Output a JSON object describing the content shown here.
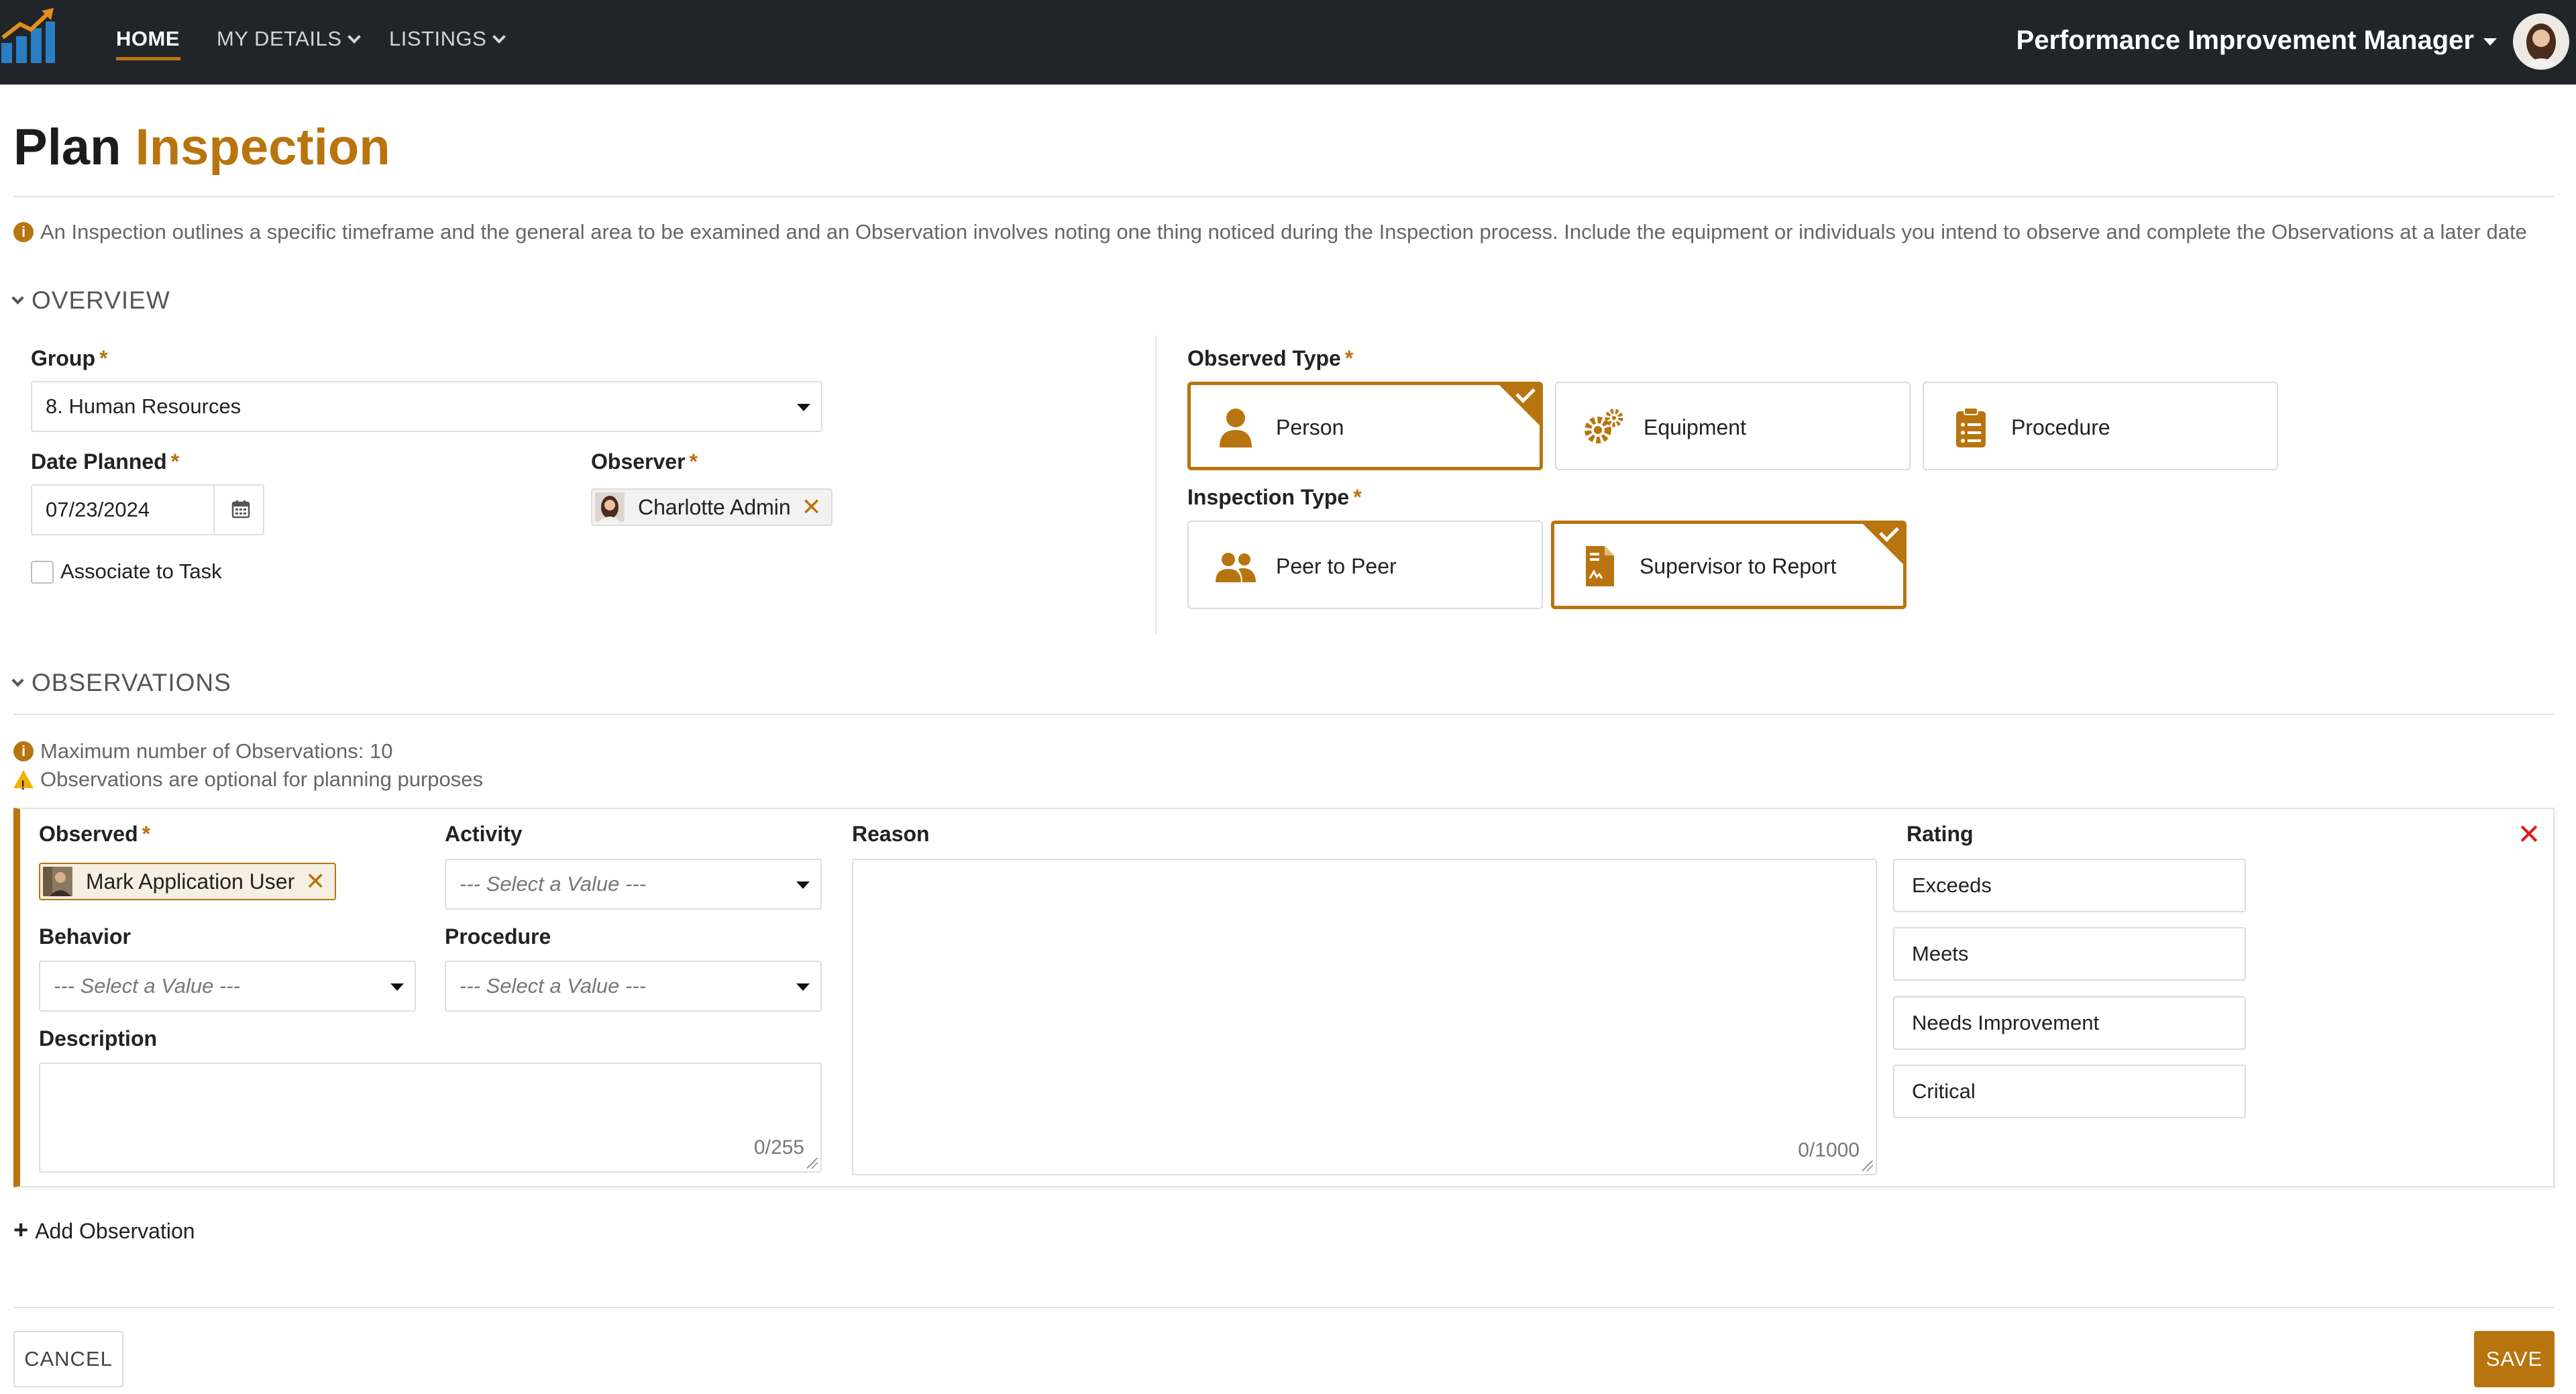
{
  "colors": {
    "accent": "#b8740e",
    "navbar": "#212529",
    "danger": "#e01b1b",
    "warning": "#f0b400"
  },
  "nav": {
    "logo_icon": "bar-chart-growth-icon",
    "items": [
      {
        "label": "HOME",
        "active": true
      },
      {
        "label": "MY DETAILS",
        "icon": "chevron-down-icon"
      },
      {
        "label": "LISTINGS",
        "icon": "chevron-down-icon"
      }
    ],
    "user_role": "Performance Improvement Manager",
    "user_role_icon": "caret-down-icon",
    "avatar_icon": "user-avatar-icon"
  },
  "header": {
    "title_plain": "Plan",
    "title_accent": "Inspection",
    "info_text": "An Inspection outlines a specific timeframe and the general area to be examined and an Observation involves noting one thing noticed during the Inspection process. Include the equipment or individuals you intend to observe and complete the Observations at a later date"
  },
  "overview": {
    "section_title": "OVERVIEW",
    "required_mark": "*",
    "group": {
      "label": "Group",
      "value": "8. Human Resources"
    },
    "date_planned": {
      "label": "Date Planned",
      "value": "07/23/2024",
      "icon": "calendar-icon"
    },
    "observer": {
      "label": "Observer",
      "value": "Charlotte Admin",
      "remove_icon": "close-icon"
    },
    "associate_task": {
      "label": "Associate to Task",
      "checked": false
    },
    "observed_type": {
      "label": "Observed Type",
      "options": [
        {
          "label": "Person",
          "icon": "person-icon",
          "selected": true
        },
        {
          "label": "Equipment",
          "icon": "gears-icon",
          "selected": false
        },
        {
          "label": "Procedure",
          "icon": "clipboard-list-icon",
          "selected": false
        }
      ]
    },
    "inspection_type": {
      "label": "Inspection Type",
      "options": [
        {
          "label": "Peer to Peer",
          "icon": "people-icon",
          "selected": false
        },
        {
          "label": "Supervisor to Report",
          "icon": "file-signature-icon",
          "selected": true
        }
      ]
    }
  },
  "observations": {
    "section_title": "OBSERVATIONS",
    "max_note": "Maximum number of Observations: 10",
    "optional_note": "Observations are optional for planning purposes",
    "card": {
      "observed": {
        "label": "Observed",
        "value": "Mark Application User",
        "remove_icon": "close-icon"
      },
      "activity": {
        "label": "Activity",
        "placeholder": "--- Select a Value ---"
      },
      "behavior": {
        "label": "Behavior",
        "placeholder": "--- Select a Value ---"
      },
      "procedure": {
        "label": "Procedure",
        "placeholder": "--- Select a Value ---"
      },
      "description": {
        "label": "Description",
        "value": "",
        "counter": "0/255"
      },
      "reason": {
        "label": "Reason",
        "value": "",
        "counter": "0/1000"
      },
      "rating": {
        "label": "Rating",
        "options": [
          "Exceeds",
          "Meets",
          "Needs Improvement",
          "Critical"
        ]
      },
      "remove_label": "✕"
    },
    "add_label": "Add Observation"
  },
  "footer": {
    "cancel_label": "CANCEL",
    "save_label": "SAVE"
  }
}
